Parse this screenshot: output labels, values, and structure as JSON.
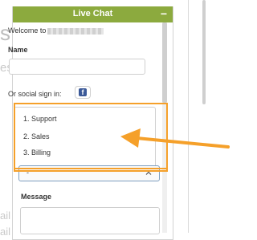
{
  "background": {
    "fragment_s": "s",
    "fragment_es": "es",
    "fragment_ail": "ail",
    "fragment_ail2": "ail"
  },
  "chat": {
    "title": "Live Chat",
    "minimize_label": "−",
    "welcome_text": "Welcome to",
    "name_label": "Name",
    "name_value": "",
    "social_text": "Or social sign in:",
    "facebook_icon_letter": "f",
    "departments": [
      "1. Support",
      "2. Sales",
      "3. Billing"
    ],
    "select_value": "-",
    "message_label": "Message",
    "message_value": ""
  },
  "colors": {
    "header": "#8caa3e",
    "highlight": "#f5a02a",
    "facebook": "#3b5998"
  }
}
